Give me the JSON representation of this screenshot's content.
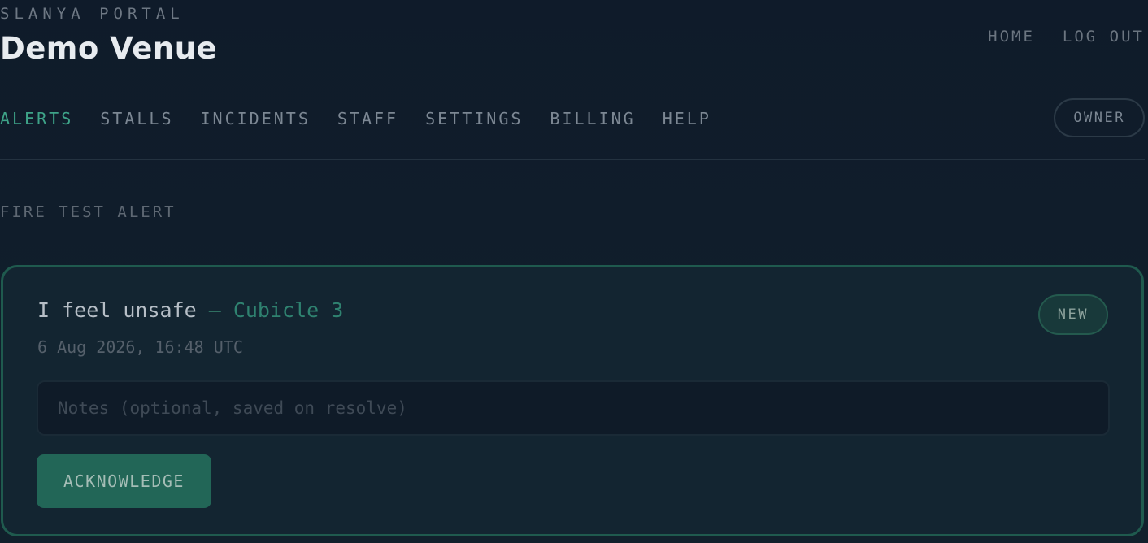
{
  "header": {
    "brand": "SLANYA PORTAL",
    "venue_name": "Demo Venue",
    "links": [
      {
        "label": "HOME"
      },
      {
        "label": "LOG OUT"
      }
    ]
  },
  "nav": {
    "tabs": [
      {
        "label": "ALERTS",
        "active": true
      },
      {
        "label": "STALLS",
        "active": false
      },
      {
        "label": "INCIDENTS",
        "active": false
      },
      {
        "label": "STAFF",
        "active": false
      },
      {
        "label": "SETTINGS",
        "active": false
      },
      {
        "label": "BILLING",
        "active": false
      },
      {
        "label": "HELP",
        "active": false
      }
    ],
    "role_badge": "OWNER"
  },
  "actions": {
    "fire_test_alert": "FIRE TEST ALERT"
  },
  "alert": {
    "message": "I feel unsafe",
    "separator": " — ",
    "location": "Cubicle 3",
    "timestamp": "6 Aug 2026, 16:48 UTC",
    "status": "NEW",
    "notes_placeholder": "Notes (optional, saved on resolve)",
    "notes_value": "",
    "acknowledge_label": "ACKNOWLEDGE"
  },
  "colors": {
    "background": "#0f1b2a",
    "accent": "#3ea388",
    "card_border": "#1f5a4e",
    "button_bg": "#226657"
  }
}
